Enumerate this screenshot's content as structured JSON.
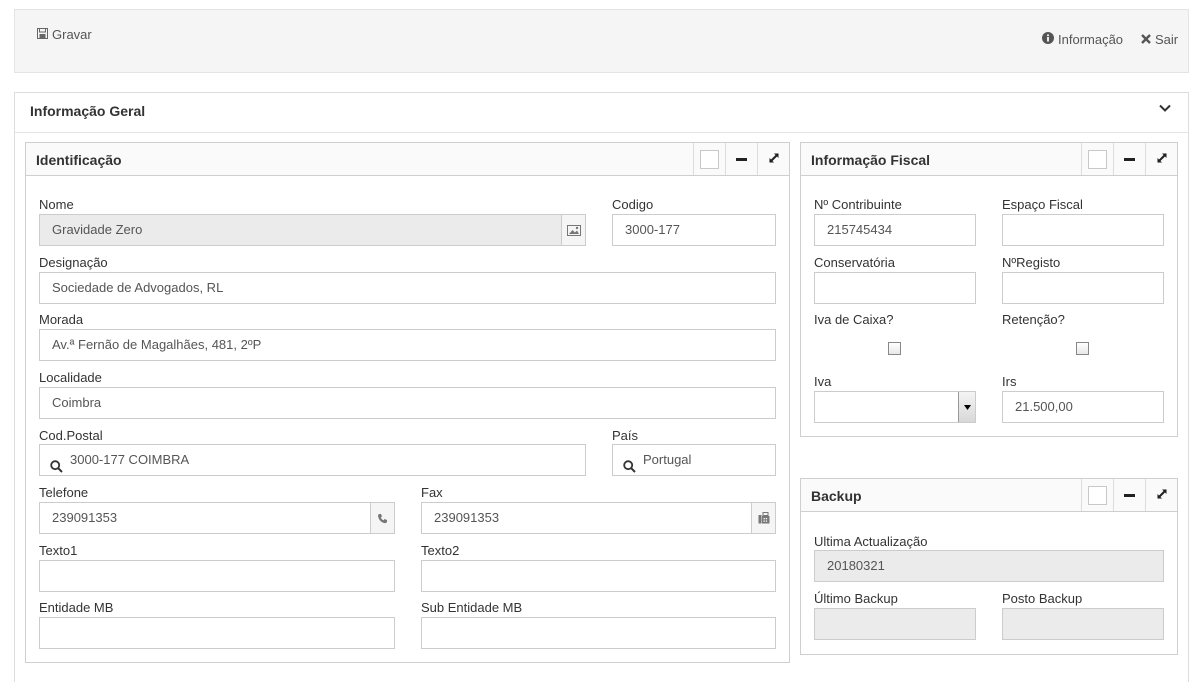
{
  "toolbar": {
    "save_label": "Gravar",
    "info_label": "Informação",
    "exit_label": "Sair"
  },
  "main": {
    "section_title": "Informação Geral"
  },
  "identificacao": {
    "title": "Identificação",
    "nome_label": "Nome",
    "nome_value": "Gravidade Zero",
    "codigo_label": "Codigo",
    "codigo_value": "3000-177",
    "designacao_label": "Designação",
    "designacao_value": "Sociedade de Advogados, RL",
    "morada_label": "Morada",
    "morada_value": "Av.ª Fernão de Magalhães, 481, 2ºP",
    "localidade_label": "Localidade",
    "localidade_value": "Coimbra",
    "codpostal_label": "Cod.Postal",
    "codpostal_value": "3000-177 COIMBRA",
    "pais_label": "País",
    "pais_value": "Portugal",
    "telefone_label": "Telefone",
    "telefone_value": "239091353",
    "fax_label": "Fax",
    "fax_value": "239091353",
    "texto1_label": "Texto1",
    "texto1_value": "",
    "texto2_label": "Texto2",
    "texto2_value": "",
    "entidade_label": "Entidade MB",
    "entidade_value": "",
    "subentidade_label": "Sub Entidade MB",
    "subentidade_value": ""
  },
  "fiscal": {
    "title": "Informação Fiscal",
    "contribuinte_label": "Nº Contribuinte",
    "contribuinte_value": "215745434",
    "espaco_label": "Espaço Fiscal",
    "espaco_value": "",
    "conservatoria_label": "Conservatória",
    "conservatoria_value": "",
    "registo_label": "NºRegisto",
    "registo_value": "",
    "ivacaixa_label": "Iva de Caixa?",
    "retencao_label": "Retenção?",
    "iva_label": "Iva",
    "iva_value": "",
    "irs_label": "Irs",
    "irs_value": "21.500,00"
  },
  "backup": {
    "title": "Backup",
    "ultima_label": "Ultima Actualização",
    "ultima_value": "20180321",
    "ultimo_backup_label": "Último Backup",
    "ultimo_backup_value": "",
    "posto_label": "Posto Backup",
    "posto_value": ""
  }
}
